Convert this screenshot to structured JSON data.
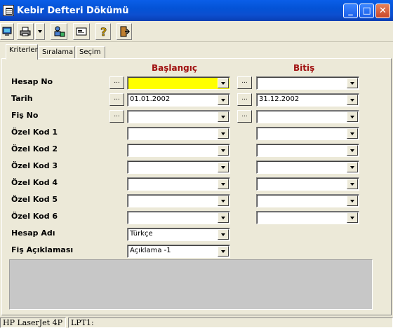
{
  "window": {
    "title": "Kebir Defteri Dökümü",
    "minimize_label": "_",
    "maximize_label": "□",
    "close_label": "✕"
  },
  "toolbar": [
    {
      "name": "computer-icon"
    },
    {
      "name": "printer-icon"
    },
    {
      "name": "dropdown-arrow-icon"
    },
    {
      "name": "user-search-icon"
    },
    {
      "name": "form-icon"
    },
    {
      "name": "help-icon"
    },
    {
      "name": "exit-icon"
    }
  ],
  "tabs": [
    "Kriterler",
    "Sıralama",
    "Seçim"
  ],
  "columns": {
    "start": "Başlangıç",
    "end": "Bitiş"
  },
  "dots_label": "...",
  "rows": [
    {
      "label": "Hesap No",
      "start": "",
      "end": "",
      "has_dots": true,
      "highlight": true
    },
    {
      "label": "Tarih",
      "start": "01.01.2002",
      "end": "31.12.2002",
      "has_dots": true
    },
    {
      "label": "Fiş No",
      "start": "",
      "end": "",
      "has_dots": true
    },
    {
      "label": "Özel Kod 1",
      "start": "",
      "end": ""
    },
    {
      "label": "Özel Kod 2",
      "start": "",
      "end": ""
    },
    {
      "label": "Özel Kod 3",
      "start": "",
      "end": ""
    },
    {
      "label": "Özel Kod 4",
      "start": "",
      "end": ""
    },
    {
      "label": "Özel Kod 5",
      "start": "",
      "end": ""
    },
    {
      "label": "Özel Kod 6",
      "start": "",
      "end": ""
    },
    {
      "label": "Hesap Adı",
      "start": "Türkçe"
    },
    {
      "label": "Fiş Açıklaması",
      "start": "Açıklama -1"
    }
  ],
  "status": {
    "printer": "HP LaserJet 4P",
    "port": "LPT1:"
  },
  "colors": {
    "column_header": "#a01010",
    "highlight": "#ffff00",
    "title_bar": "#0453d6"
  }
}
